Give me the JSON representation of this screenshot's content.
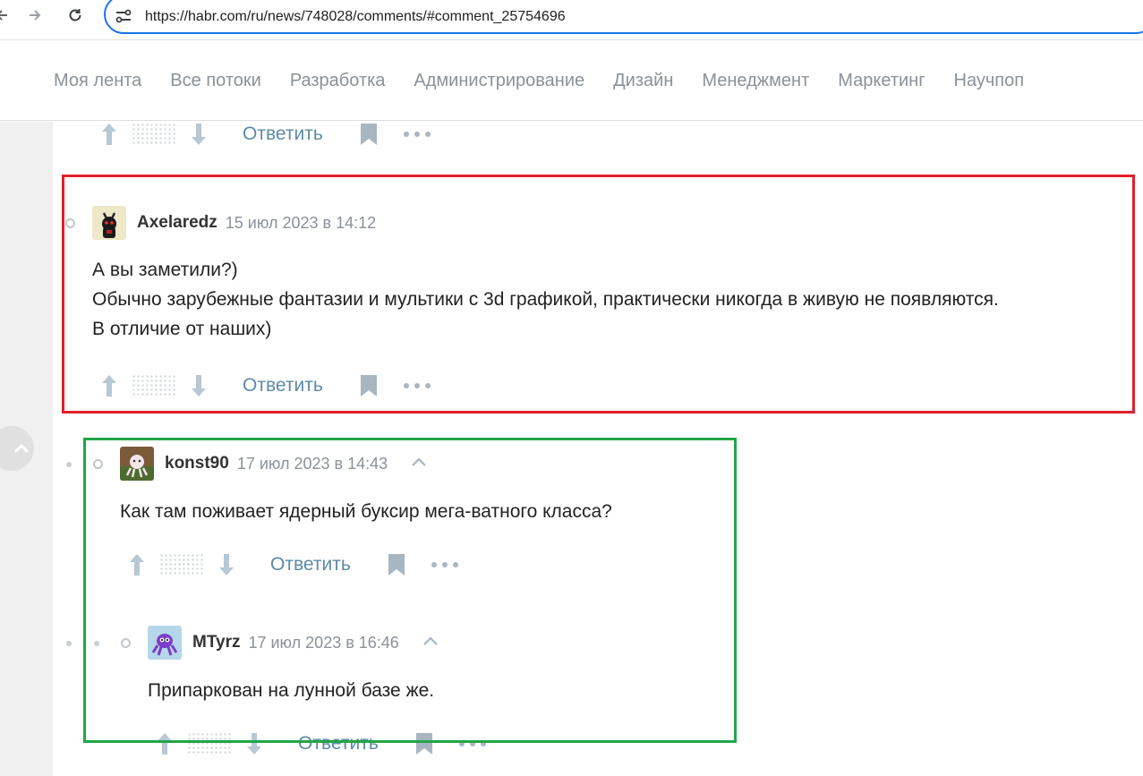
{
  "browser": {
    "url": "https://habr.com/ru/news/748028/comments/#comment_25754696"
  },
  "nav": {
    "items": [
      "Моя лента",
      "Все потоки",
      "Разработка",
      "Администрирование",
      "Дизайн",
      "Менеджмент",
      "Маркетинг",
      "Научпоп"
    ]
  },
  "comment_actions": {
    "reply_label": "Ответить"
  },
  "comments": [
    {
      "username": "Axelaredz",
      "timestamp": "15 июл 2023 в 14:12",
      "lines": [
        "А вы заметили?)",
        "Обычно зарубежные фантазии и мультики с 3d графикой, практически никогда в живую не появляются.",
        "В отличие от наших)"
      ]
    },
    {
      "username": "konst90",
      "timestamp": "17 июл 2023 в 14:43",
      "lines": [
        "Как там поживает ядерный буксир мега-ватного класса?"
      ]
    },
    {
      "username": "MTyrz",
      "timestamp": "17 июл 2023 в 16:46",
      "lines": [
        "Припаркован на лунной базе же."
      ]
    }
  ],
  "colors": {
    "highlight_red": "#e0202c",
    "highlight_green": "#22a548",
    "reply_link": "#5e8aa6",
    "address_bar_border": "#1a73e8"
  },
  "icons": [
    "back-arrow-icon",
    "forward-arrow-icon",
    "reload-icon",
    "site-info-icon",
    "upvote-arrow-icon",
    "downvote-arrow-icon",
    "bookmark-icon",
    "more-dots-icon",
    "collapse-chevron-icon",
    "scroll-up-icon"
  ]
}
